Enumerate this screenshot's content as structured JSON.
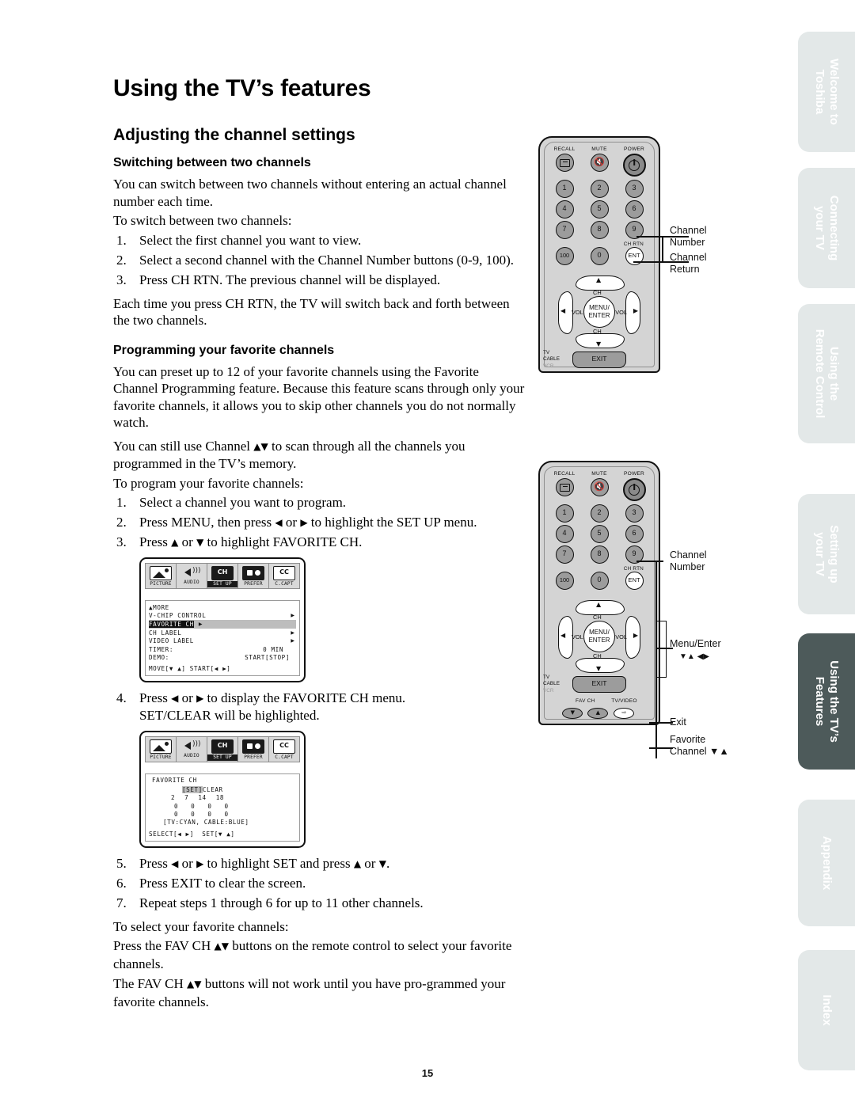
{
  "page": {
    "title": "Using the TV’s features",
    "number": "15"
  },
  "sections": {
    "channel_settings_heading": "Adjusting the channel settings",
    "switching_heading": "Switching between two channels",
    "switching_intro": "You can switch between two channels without entering an actual channel number each time.",
    "switching_lead": "To switch between two channels:",
    "switching_steps": [
      "Select the first channel you want to view.",
      "Select a second channel with the Channel Number buttons (0-9, 100).",
      "Press CH RTN. The previous channel will be displayed."
    ],
    "switching_outro": "Each time you press CH RTN, the TV will switch back and forth between the two channels.",
    "favorite_heading": "Programming your favorite channels",
    "favorite_p1": "You can preset up to 12 of your favorite channels using the Favorite Channel Programming feature. Because this feature scans through only your favorite channels, it allows you to skip other channels you do not normally watch.",
    "favorite_p2_a": "You can still use Channel ",
    "favorite_p2_b": " to scan through all the channels you programmed in the TV’s memory.",
    "favorite_lead": "To program your favorite channels:",
    "step1": "Select a channel you want to program.",
    "step2_a": "Press MENU, then press ",
    "step2_b": " or ",
    "step2_c": " to highlight the SET UP menu.",
    "step3_a": "Press ",
    "step3_b": " or ",
    "step3_c": " to highlight FAVORITE CH.",
    "step4_a": "Press ",
    "step4_b": " or ",
    "step4_c": " to display the FAVORITE CH menu.",
    "step4_line2": "SET/CLEAR will be highlighted.",
    "step5_a": "Press ",
    "step5_b": " or ",
    "step5_c": " to highlight SET and press ",
    "step5_d": " or ",
    "step5_e": ".",
    "step6": "Press EXIT to clear the screen.",
    "step7": "Repeat steps 1 through 6 for up to 11 other channels.",
    "select_lead": "To select your favorite channels:",
    "select_p1_a": "Press the FAV CH ",
    "select_p1_b": " buttons on the remote control to select your favorite channels.",
    "select_p2_a": "The FAV CH ",
    "select_p2_b": " buttons will not work until you have pro-grammed your favorite channels."
  },
  "glyphs": {
    "left": "◀",
    "right": "▶",
    "up": "▲",
    "down": "▼",
    "updown": "▲▼",
    "downup": "▼▲",
    "leftright": "◀▶"
  },
  "osd_menu_1": {
    "icons": [
      {
        "label": "PICTURE",
        "icon": "picture-icon",
        "active": false
      },
      {
        "label": "AUDIO",
        "icon": "audio-icon",
        "active": false
      },
      {
        "label": "SET UP",
        "icon": "setup-icon",
        "active": true
      },
      {
        "label": "PREFER",
        "icon": "prefer-icon",
        "active": false
      },
      {
        "label": "C.CAPT",
        "icon": "closed-caption-icon",
        "active": false
      }
    ],
    "rows": [
      {
        "label": "▲MORE",
        "arrow": false,
        "highlight": false
      },
      {
        "label": "V-CHIP CONTROL",
        "arrow": true,
        "highlight": false
      },
      {
        "label": "FAVORITE CH",
        "arrow": true,
        "highlight": true
      },
      {
        "label": "CH LABEL",
        "arrow": true,
        "highlight": false
      },
      {
        "label": "VIDEO LABEL",
        "arrow": true,
        "highlight": false
      }
    ],
    "timer_label": "TIMER:",
    "timer_value": "0 MIN",
    "demo_label": "DEMO:",
    "demo_value": "START[STOP]",
    "footer": "MOVE[▼ ▲] START[◀ ▶]"
  },
  "osd_menu_2": {
    "icons": [
      {
        "label": "PICTURE",
        "icon": "picture-icon",
        "active": false
      },
      {
        "label": "AUDIO",
        "icon": "audio-icon",
        "active": false
      },
      {
        "label": "SET UP",
        "icon": "setup-icon",
        "active": true
      },
      {
        "label": "PREFER",
        "icon": "prefer-icon",
        "active": false
      },
      {
        "label": "C.CAPT",
        "icon": "closed-caption-icon",
        "active": false
      }
    ],
    "title": "FAVORITE CH",
    "set_label": "[SET]",
    "clear_label": "CLEAR",
    "channel_rows": [
      [
        "2",
        "7",
        "14",
        "18"
      ],
      [
        "0",
        "0",
        "0",
        "0"
      ],
      [
        "0",
        "0",
        "0",
        "0"
      ]
    ],
    "legend": "[TV:CYAN, CABLE:BLUE]",
    "footer": "SELECT[◀ ▶]  SET[▼ ▲]"
  },
  "remote": {
    "recall_label": "RECALL",
    "mute_label": "MUTE",
    "power_label": "POWER",
    "keys": [
      [
        "1",
        "2",
        "3"
      ],
      [
        "4",
        "5",
        "6"
      ],
      [
        "7",
        "8",
        "9"
      ],
      [
        "100",
        "0",
        "ENT"
      ]
    ],
    "ch_rtn_label": "CH RTN",
    "ch_label_top": "CH",
    "ch_label_bottom": "CH",
    "vol_left": "VOL",
    "vol_right": "VOL",
    "menu_line1": "MENU/",
    "menu_line2": "ENTER",
    "switch_tv": "TV",
    "switch_cable": "CABLE",
    "switch_vcr": "VCR",
    "exit_label": "EXIT",
    "fav_ch_label": "FAV CH",
    "tv_video_label": "TV/VIDEO"
  },
  "callouts_top": [
    {
      "line1": "Channel",
      "line2": "Number"
    },
    {
      "line1": "Channel",
      "line2": "Return"
    }
  ],
  "callouts_bottom": {
    "channel_number_l1": "Channel",
    "channel_number_l2": "Number",
    "menu_enter": "Menu/Enter",
    "menu_enter_arrows": "▼▲ ◀▶",
    "exit": "Exit",
    "favorite_l1": "Favorite",
    "favorite_l2": "Channel ▼▲"
  },
  "rail_tabs": [
    {
      "line1": "Welcome to",
      "line2": "Toshiba",
      "active": false
    },
    {
      "line1": "Connecting",
      "line2": "your TV",
      "active": false
    },
    {
      "line1": "Using the",
      "line2": "Remote Control",
      "active": false
    },
    {
      "line1": "Setting up",
      "line2": "your TV",
      "active": false
    },
    {
      "line1": "Using the TV’s",
      "line2": "Features",
      "active": true
    },
    {
      "line1": "Appendix",
      "line2": "",
      "active": false
    },
    {
      "line1": "Index",
      "line2": "",
      "active": false
    }
  ]
}
